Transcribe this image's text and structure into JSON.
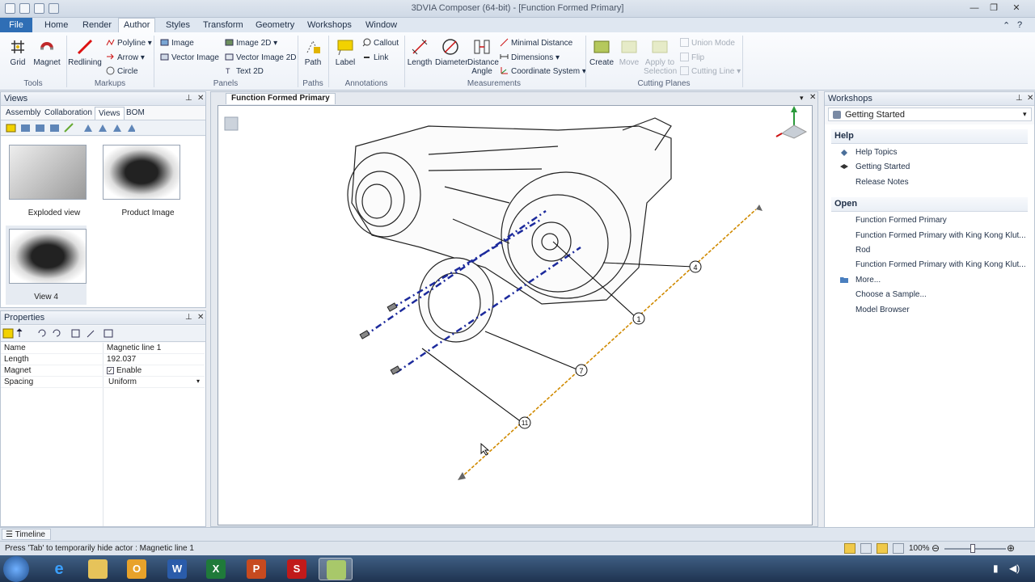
{
  "titlebar": {
    "title": "3DVIA Composer (64-bit) - [Function Formed Primary]",
    "minimize": "—",
    "maximize": "❐",
    "close": "✕"
  },
  "ribbon_tabs": [
    "File",
    "Home",
    "Render",
    "Author",
    "Styles",
    "Transform",
    "Geometry",
    "Workshops",
    "Window"
  ],
  "active_tab": "Author",
  "ribbon": {
    "tools": {
      "grid": "Grid",
      "magnet": "Magnet",
      "group": "Tools"
    },
    "markups": {
      "redlining": "Redlining",
      "polyline": "Polyline",
      "arrow": "Arrow",
      "circle": "Circle",
      "group": "Markups"
    },
    "panels": {
      "image": "Image",
      "vector_image": "Vector Image",
      "image_2d": "Image 2D",
      "vector_image_2d": "Vector Image 2D",
      "text_2d": "Text 2D",
      "group": "Panels"
    },
    "paths": {
      "path": "Path",
      "group": "Paths"
    },
    "annotations": {
      "label": "Label",
      "callout": "Callout",
      "link": "Link",
      "group": "Annotations"
    },
    "measurements": {
      "length": "Length",
      "diameter": "Diameter",
      "distance_angle_1": "Distance",
      "distance_angle_2": "Angle",
      "minimal_distance": "Minimal Distance",
      "dimensions": "Dimensions",
      "coordinate_system": "Coordinate System",
      "group": "Measurements"
    },
    "cutting_planes": {
      "create": "Create",
      "move": "Move",
      "apply_1": "Apply to",
      "apply_2": "Selection",
      "union_mode": "Union Mode",
      "flip": "Flip",
      "cutting_line": "Cutting Line",
      "group": "Cutting Planes"
    }
  },
  "views_panel": {
    "title": "Views",
    "tabs": [
      "Assembly",
      "Collaboration",
      "Views",
      "BOM"
    ],
    "active_tab": "Views",
    "thumbnails": [
      "Exploded view",
      "Product Image",
      "View 4"
    ]
  },
  "properties_panel": {
    "title": "Properties",
    "rows": [
      {
        "key": "Name",
        "value": "Magnetic line 1"
      },
      {
        "key": "Length",
        "value": "192.037"
      },
      {
        "key": "Magnet",
        "value": "Enable"
      },
      {
        "key": "Spacing",
        "value": "Uniform"
      }
    ]
  },
  "viewport": {
    "tab": "Function Formed Primary",
    "callouts": [
      "4",
      "1",
      "7",
      "11"
    ]
  },
  "workshops": {
    "title": "Workshops",
    "selector": "Getting Started",
    "help_header": "Help",
    "help": [
      "Help Topics",
      "Getting Started",
      "Release Notes"
    ],
    "open_header": "Open",
    "open": [
      "Function Formed Primary",
      "Function Formed Primary with King Kong Klut...",
      "Rod",
      "Function Formed Primary with King Kong Klut...",
      "More...",
      "Choose a Sample...",
      "Model Browser"
    ]
  },
  "timeline": {
    "label": "Timeline"
  },
  "status": {
    "message": "Press 'Tab' to temporarily hide actor : Magnetic line 1",
    "zoom": "100%"
  },
  "colors": {
    "accent": "#2f6eb5",
    "magnetic_line": "#d08a00",
    "explode_line": "#1c2a9c"
  }
}
